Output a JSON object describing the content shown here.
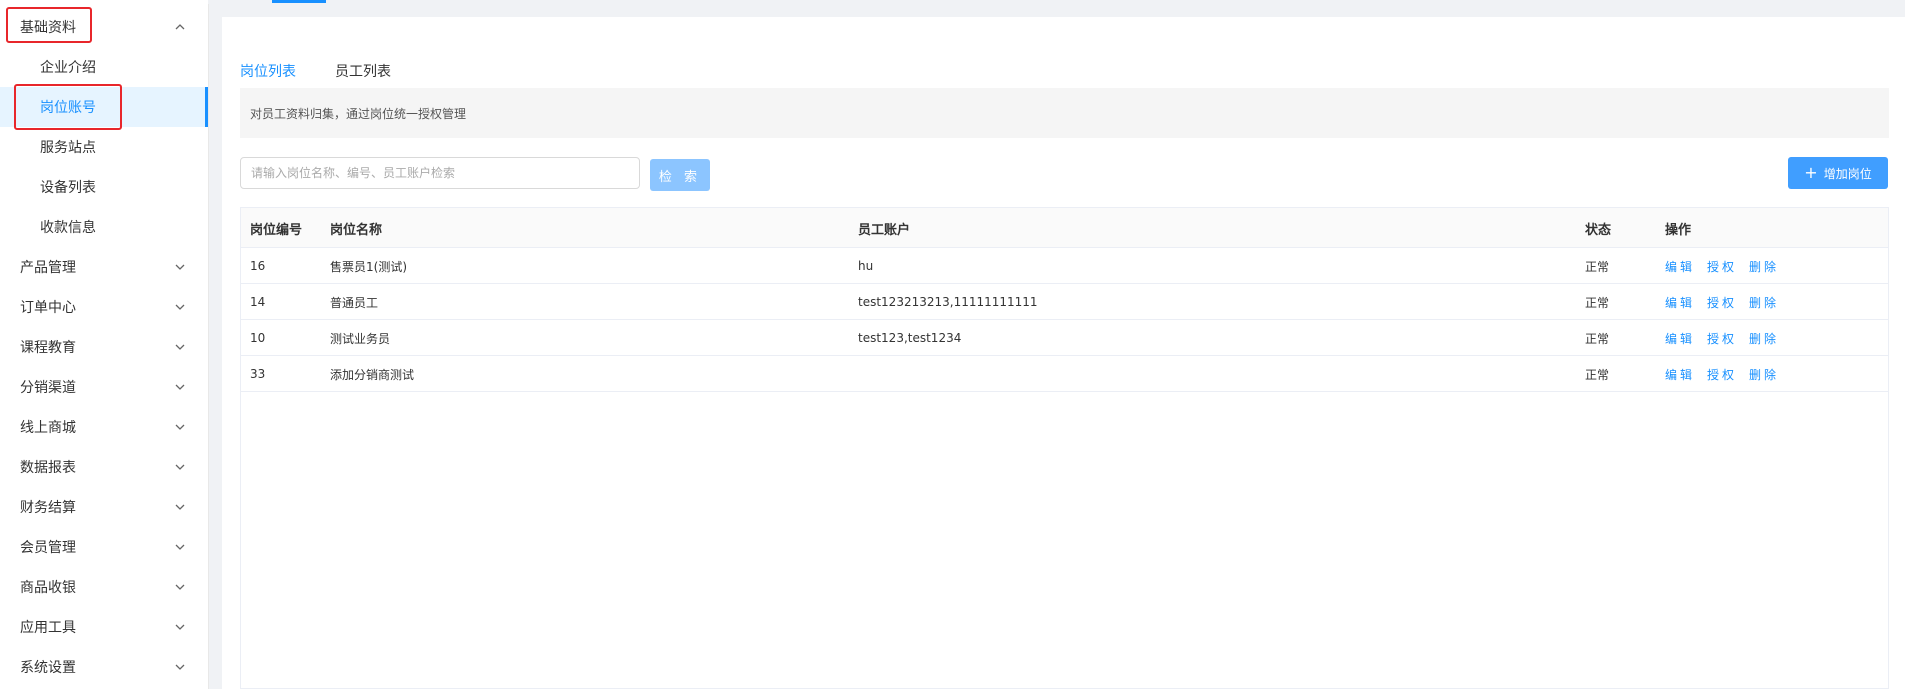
{
  "sidebar": {
    "group_base": {
      "label": "基础资料"
    },
    "sub_items": [
      "企业介绍",
      "岗位账号",
      "服务站点",
      "设备列表",
      "收款信息"
    ],
    "menu_items": [
      "产品管理",
      "订单中心",
      "课程教育",
      "分销渠道",
      "线上商城",
      "数据报表",
      "财务结算",
      "会员管理",
      "商品收银",
      "应用工具",
      "系统设置"
    ]
  },
  "tabs": [
    "岗位列表",
    "员工列表"
  ],
  "info": "对员工资料归集，通过岗位统一授权管理",
  "search": {
    "placeholder": "请输入岗位名称、编号、员工账户检索",
    "button": "检 索"
  },
  "add_button": "增加岗位",
  "table": {
    "headers": [
      "岗位编号",
      "岗位名称",
      "员工账户",
      "状态",
      "操作"
    ],
    "rows": [
      {
        "id": "16",
        "name": "售票员1(测试)",
        "accounts": "hu",
        "status": "正常"
      },
      {
        "id": "14",
        "name": "普通员工",
        "accounts": "test123213213,11111111111",
        "status": "正常"
      },
      {
        "id": "10",
        "name": "测试业务员",
        "accounts": "test123,test1234",
        "status": "正常"
      },
      {
        "id": "33",
        "name": "添加分销商测试",
        "accounts": "",
        "status": "正常"
      }
    ],
    "ops": {
      "edit": "编辑",
      "auth": "授权",
      "delete": "删除"
    }
  },
  "colors": {
    "accent": "#1890ff",
    "highlight_box": "#e8262b",
    "button_disabled": "#8cc5ff",
    "button_primary": "#409eff"
  }
}
